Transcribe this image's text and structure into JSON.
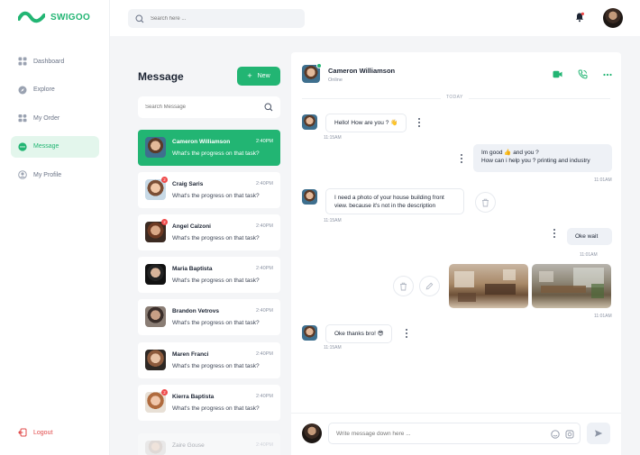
{
  "brand": {
    "name": "SWIGOO",
    "color": "#22b573"
  },
  "top_search": {
    "placeholder": "Search here ..."
  },
  "nav": [
    {
      "label": "Dashboard",
      "icon": "grid-icon",
      "active": false
    },
    {
      "label": "Explore",
      "icon": "compass-icon",
      "active": false
    },
    {
      "label": "My Order",
      "icon": "order-icon",
      "active": false
    },
    {
      "label": "Message",
      "icon": "chat-icon",
      "active": true
    },
    {
      "label": "My Profile",
      "icon": "user-icon",
      "active": false
    }
  ],
  "logout": {
    "label": "Logout"
  },
  "messages_panel": {
    "title": "Message",
    "new_button": "New",
    "search_placeholder": "Search Message",
    "conversations": [
      {
        "name": "Cameron Williamson",
        "time": "2:40PM",
        "preview": "What's the progress on that task?",
        "active": true,
        "badge": ""
      },
      {
        "name": "Craig Saris",
        "time": "2:40PM",
        "preview": "What's the progress on that task?",
        "active": false,
        "badge": "2"
      },
      {
        "name": "Angel Calzoni",
        "time": "2:40PM",
        "preview": "What's the progress on that task?",
        "active": false,
        "badge": "2"
      },
      {
        "name": "Maria Baptista",
        "time": "2:40PM",
        "preview": "What's the progress on that task?",
        "active": false,
        "badge": ""
      },
      {
        "name": "Brandon Vetrovs",
        "time": "2:40PM",
        "preview": "What's the progress on that task?",
        "active": false,
        "badge": ""
      },
      {
        "name": "Maren Franci",
        "time": "2:40PM",
        "preview": "What's the progress on that task?",
        "active": false,
        "badge": ""
      },
      {
        "name": "Kierra Baptista",
        "time": "2:40PM",
        "preview": "What's the progress on that task?",
        "active": false,
        "badge": "2"
      },
      {
        "name": "Zaire Gouse",
        "time": "2:40PM",
        "preview": "",
        "active": false,
        "badge": ""
      }
    ]
  },
  "chat": {
    "contact_name": "Cameron Williamson",
    "status": "Online",
    "day_divider": "TODAY",
    "messages": {
      "m1": {
        "text": "Hello! How are you ? 👋",
        "time": "11:15AM"
      },
      "m2": {
        "line1": "Im good 👍 and you ?",
        "line2": "How can i help you ? printing and industry",
        "time": "11:01AM"
      },
      "m3": {
        "line1": "I need a photo of your house building front",
        "line2": "view. because it's not in the description",
        "time": "11:15AM"
      },
      "m4": {
        "text": "Oke wait",
        "time": "11:01AM"
      },
      "m5": {
        "time": "11:01AM"
      },
      "m6": {
        "text": "Oke thanks bro! 😎",
        "time": "11:15AM"
      }
    },
    "compose_placeholder": "Write message down here ..."
  }
}
